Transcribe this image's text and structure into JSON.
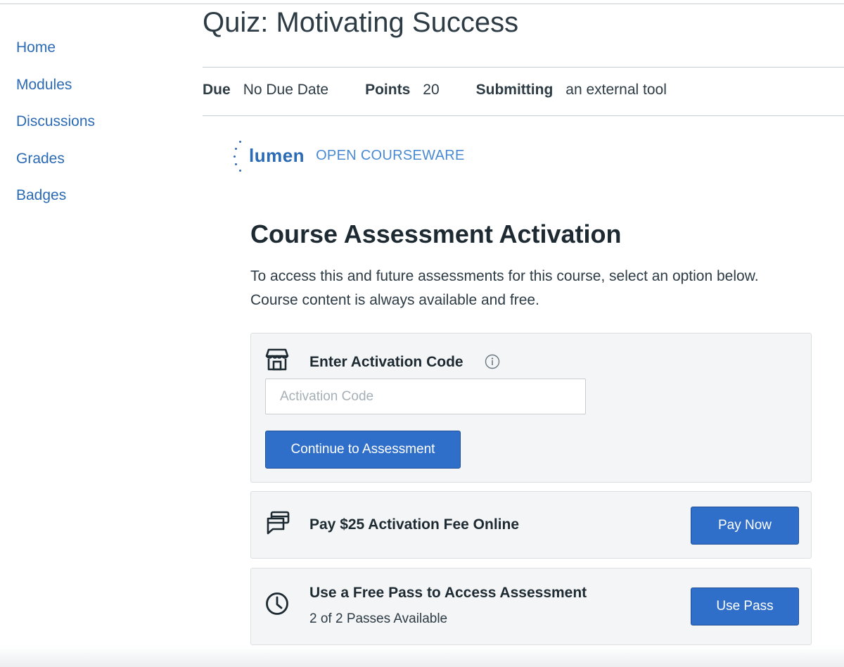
{
  "sidebar": {
    "items": [
      {
        "label": "Home"
      },
      {
        "label": "Modules"
      },
      {
        "label": "Discussions"
      },
      {
        "label": "Grades"
      },
      {
        "label": "Badges"
      }
    ]
  },
  "page": {
    "title": "Quiz: Motivating Success"
  },
  "meta": {
    "due_label": "Due",
    "due_value": "No Due Date",
    "points_label": "Points",
    "points_value": "20",
    "submitting_label": "Submitting",
    "submitting_value": "an external tool"
  },
  "logo": {
    "word": "lumen",
    "tagline": "OPEN COURSEWARE"
  },
  "activation": {
    "heading": "Course Assessment Activation",
    "intro_line1": "To access this and future assessments for this course, select an option below.",
    "intro_line2": "Course content is always available and free."
  },
  "code_card": {
    "title": "Enter Activation Code",
    "input_value": "",
    "input_placeholder": "Activation Code",
    "button_label": "Continue to Assessment"
  },
  "pay_card": {
    "title": "Pay $25 Activation Fee Online",
    "button_label": "Pay Now"
  },
  "pass_card": {
    "title": "Use a Free Pass to Access Assessment",
    "subtitle": "2 of 2 Passes Available",
    "button_label": "Use Pass"
  },
  "icons": {
    "store": "storefront-icon",
    "info": "info-icon",
    "payment": "payment-card-icon",
    "clock": "clock-icon"
  },
  "colors": {
    "link": "#2b6ab5",
    "button": "#2f6fc9",
    "card_bg": "#f4f5f6",
    "text": "#2d3b45"
  }
}
